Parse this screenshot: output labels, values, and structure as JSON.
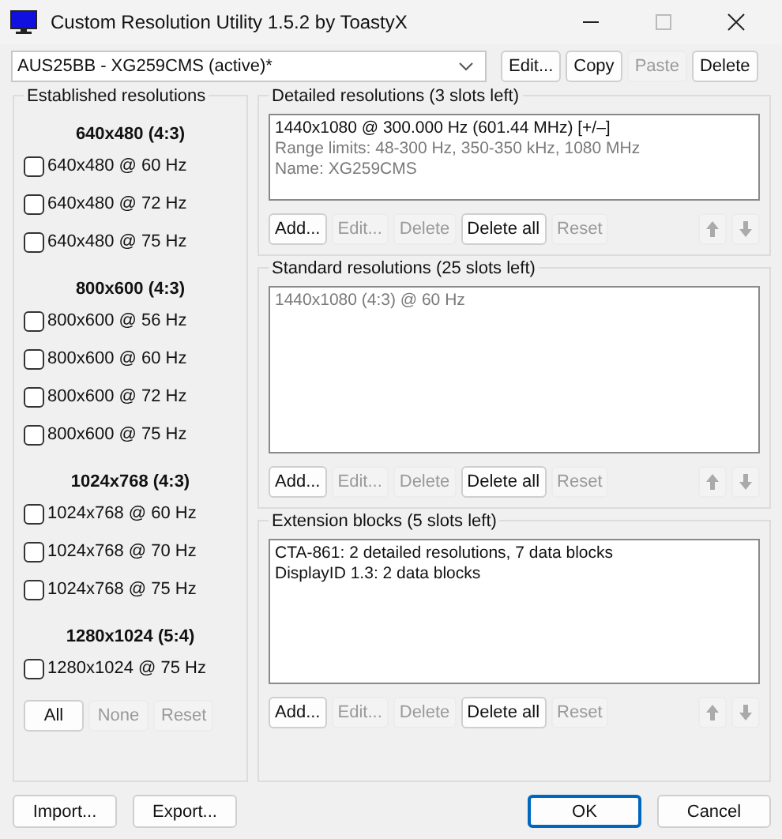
{
  "window": {
    "title": "Custom Resolution Utility 1.5.2 by ToastyX"
  },
  "monitor": {
    "value": "AUS25BB - XG259CMS (active)*"
  },
  "monitor_buttons": [
    {
      "label": "Edit...",
      "disabled": false
    },
    {
      "label": "Copy",
      "disabled": false
    },
    {
      "label": "Paste",
      "disabled": true
    },
    {
      "label": "Delete",
      "disabled": false
    }
  ],
  "established": {
    "title": "Established resolutions",
    "groups": [
      {
        "heading": "640x480 (4:3)",
        "items": [
          {
            "label": "640x480 @ 60 Hz",
            "checked": false
          },
          {
            "label": "640x480 @ 72 Hz",
            "checked": false
          },
          {
            "label": "640x480 @ 75 Hz",
            "checked": false
          }
        ]
      },
      {
        "heading": "800x600 (4:3)",
        "items": [
          {
            "label": "800x600 @ 56 Hz",
            "checked": false
          },
          {
            "label": "800x600 @ 60 Hz",
            "checked": false
          },
          {
            "label": "800x600 @ 72 Hz",
            "checked": false
          },
          {
            "label": "800x600 @ 75 Hz",
            "checked": false
          }
        ]
      },
      {
        "heading": "1024x768 (4:3)",
        "items": [
          {
            "label": "1024x768 @ 60 Hz",
            "checked": false
          },
          {
            "label": "1024x768 @ 70 Hz",
            "checked": false
          },
          {
            "label": "1024x768 @ 75 Hz",
            "checked": false
          }
        ]
      },
      {
        "heading": "1280x1024 (5:4)",
        "items": [
          {
            "label": "1280x1024 @ 75 Hz",
            "checked": false
          }
        ]
      }
    ],
    "buttons": [
      {
        "label": "All",
        "disabled": false
      },
      {
        "label": "None",
        "disabled": true
      },
      {
        "label": "Reset",
        "disabled": true
      }
    ]
  },
  "sections": [
    {
      "title": "Detailed resolutions (3 slots left)",
      "lines": [
        {
          "text": "1440x1080 @ 300.000 Hz (601.44 MHz) [+/–]",
          "dimmed": false
        },
        {
          "text": "Range limits: 48-300 Hz, 350-350 kHz, 1080 MHz",
          "dimmed": true
        },
        {
          "text": "Name: XG259CMS",
          "dimmed": true
        }
      ],
      "buttons": [
        {
          "label": "Add...",
          "disabled": false
        },
        {
          "label": "Edit...",
          "disabled": true
        },
        {
          "label": "Delete",
          "disabled": true
        },
        {
          "label": "Delete all",
          "disabled": false
        },
        {
          "label": "Reset",
          "disabled": true
        }
      ],
      "arrows": [
        {
          "kind": "up",
          "disabled": true
        },
        {
          "kind": "down",
          "disabled": true
        }
      ]
    },
    {
      "title": "Standard resolutions (25 slots left)",
      "lines": [
        {
          "text": "1440x1080 (4:3) @ 60 Hz",
          "dimmed": true
        }
      ],
      "buttons": [
        {
          "label": "Add...",
          "disabled": false
        },
        {
          "label": "Edit...",
          "disabled": true
        },
        {
          "label": "Delete",
          "disabled": true
        },
        {
          "label": "Delete all",
          "disabled": false
        },
        {
          "label": "Reset",
          "disabled": true
        }
      ],
      "arrows": [
        {
          "kind": "up",
          "disabled": true
        },
        {
          "kind": "down",
          "disabled": true
        }
      ]
    },
    {
      "title": "Extension blocks (5 slots left)",
      "lines": [
        {
          "text": "CTA-861: 2 detailed resolutions, 7 data blocks",
          "dimmed": false
        },
        {
          "text": "DisplayID 1.3: 2 data blocks",
          "dimmed": false
        }
      ],
      "buttons": [
        {
          "label": "Add...",
          "disabled": false
        },
        {
          "label": "Edit...",
          "disabled": true
        },
        {
          "label": "Delete",
          "disabled": true
        },
        {
          "label": "Delete all",
          "disabled": false
        },
        {
          "label": "Reset",
          "disabled": true
        }
      ],
      "arrows": [
        {
          "kind": "up",
          "disabled": true
        },
        {
          "kind": "down",
          "disabled": true
        }
      ]
    }
  ],
  "footer_left": [
    {
      "label": "Import...",
      "disabled": false
    },
    {
      "label": "Export...",
      "disabled": false
    }
  ],
  "footer_right": [
    {
      "label": "OK",
      "disabled": false,
      "default": true
    },
    {
      "label": "Cancel",
      "disabled": false,
      "default": false
    }
  ]
}
